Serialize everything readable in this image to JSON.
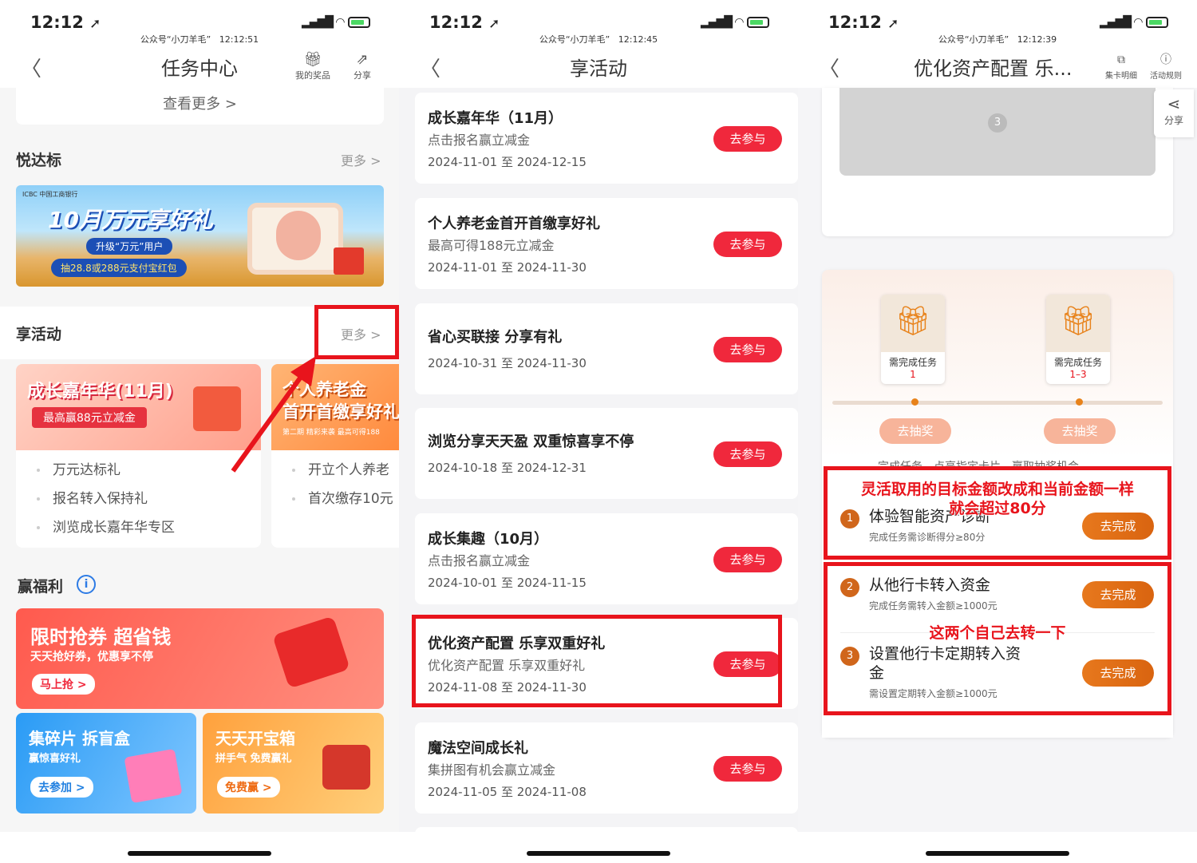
{
  "watermark": "公众号“小刀羊毛”",
  "panels": {
    "p1": {
      "status": {
        "time": "12:12",
        "stamp": "12:12:51"
      },
      "nav": {
        "title": "任务中心",
        "btn1": "我的奖品",
        "btn2": "分享"
      },
      "see_more": "查看更多 >",
      "yueda": {
        "title": "悦达标",
        "more": "更多 >"
      },
      "banner": {
        "title": "10月万元享好礼",
        "sub": "升级“万元”用户",
        "line": "抽28.8或288元支付宝红包",
        "badge": "ICBC 中国工商银行"
      },
      "xiang": {
        "title": "享活动",
        "more": "更多 >"
      },
      "card1": {
        "title": "成长嘉年华(11月)",
        "sub": "最高赢88元立减金",
        "items": [
          "万元达标礼",
          "报名转入保持礼",
          "浏览成长嘉年华专区"
        ]
      },
      "card2": {
        "title": "个人养老金",
        "title2": "首开首缴享好礼",
        "tags": "第二期 精彩来袭    最高可得188",
        "items": [
          "开立个人养老",
          "首次缴存10元"
        ]
      },
      "fuli": {
        "title": "赢福利",
        "info": "i"
      },
      "promo1": {
        "title": "限时抢券 超省钱",
        "sub": "天天抢好券，优惠享不停",
        "btn": "马上抢 >"
      },
      "promo2": {
        "title": "集碎片 拆盲盒",
        "sub": "赢惊喜好礼",
        "btn": "去参加 >"
      },
      "promo3": {
        "title": "天天开宝箱",
        "sub": "拼手气 免费赢礼",
        "btn": "免费赢 >"
      }
    },
    "p2": {
      "status": {
        "time": "12:12",
        "stamp": "12:12:45"
      },
      "nav": {
        "title": "享活动"
      },
      "join_label": "去参与",
      "activities": [
        {
          "title": "成长嘉年华（11月）",
          "sub": "点击报名赢立减金",
          "date": "2024-11-01 至 2024-12-15"
        },
        {
          "title": "个人养老金首开首缴享好礼",
          "sub": "最高可得188元立减金",
          "date": "2024-11-01 至 2024-11-30"
        },
        {
          "title": "省心买联接 分享有礼",
          "sub": "",
          "date": "2024-10-31 至 2024-11-30"
        },
        {
          "title": "浏览分享天天盈 双重惊喜享不停",
          "sub": "",
          "date": "2024-10-18 至 2024-12-31"
        },
        {
          "title": "成长集趣（10月）",
          "sub": "点击报名赢立减金",
          "date": "2024-10-01 至 2024-11-15"
        },
        {
          "title": "优化资产配置 乐享双重好礼",
          "sub": "优化资产配置 乐享双重好礼",
          "date": "2024-11-08 至 2024-11-30"
        },
        {
          "title": "魔法空间成长礼",
          "sub": "集拼图有机会赢立减金",
          "date": "2024-11-05 至 2024-11-08"
        }
      ]
    },
    "p3": {
      "status": {
        "time": "12:12",
        "stamp": "12:12:39"
      },
      "nav": {
        "title": "优化资产配置 乐...",
        "btn1": "集卡明细",
        "btn2": "活动规则"
      },
      "share": "分享",
      "step3": "3",
      "gifts": [
        {
          "label": "需完成任务",
          "n": "1"
        },
        {
          "label": "需完成任务",
          "n": "1–3"
        }
      ],
      "lottery": "去抽奖",
      "hint": "完成任务，点亮指定卡片，赢取抽奖机会",
      "tasks": [
        {
          "n": "1",
          "title": "体验智能资产诊断",
          "sub": "完成任务需诊断得分≥80分",
          "btn": "去完成"
        },
        {
          "n": "2",
          "title": "从他行卡转入资金",
          "sub": "完成任务需转入金额≥1000元",
          "btn": "去完成"
        },
        {
          "n": "3",
          "title": "设置他行卡定期转入资",
          "title2": "金",
          "sub": "需设置定期转入金额≥1000元",
          "btn": "去完成"
        }
      ],
      "anno1a": "灵活取用的目标金额改成和当前金额一样",
      "anno1b": "就会超过80分",
      "anno2": "这两个自己去转一下"
    }
  },
  "colors": {
    "accent": "#f0283c",
    "annotation": "#e8141c",
    "task_btn": "#d96410"
  }
}
